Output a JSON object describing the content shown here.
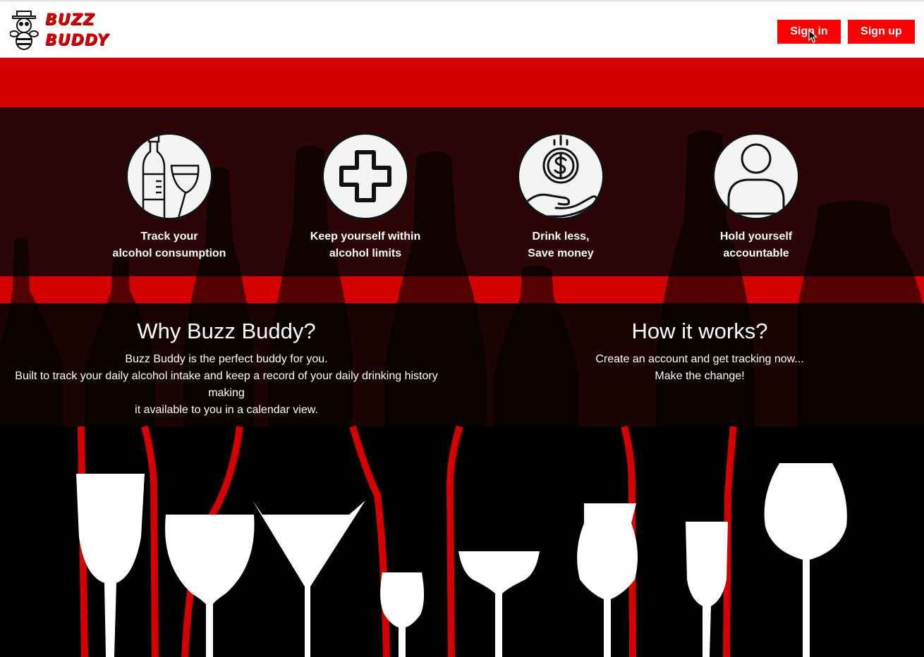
{
  "brand": {
    "line1": "BUZZ",
    "line2": "BUDDY",
    "logo_icon": "bee-mascot-icon"
  },
  "nav": {
    "signin_label": "Sign in",
    "signup_label": "Sign up"
  },
  "colors": {
    "accent": "#ff0000",
    "band_red": "#d40000",
    "dark_overlay": "#2a0505",
    "background": "#000000"
  },
  "features": [
    {
      "icon": "wine-bottle-glass-icon",
      "line1": "Track your",
      "line2": "alcohol consumption"
    },
    {
      "icon": "medical-cross-icon",
      "line1": "Keep yourself within",
      "line2": "alcohol limits"
    },
    {
      "icon": "money-hand-icon",
      "line1": "Drink less,",
      "line2": "Save money"
    },
    {
      "icon": "user-icon",
      "line1": "Hold yourself",
      "line2": "accountable"
    }
  ],
  "why": {
    "title": "Why Buzz Buddy?",
    "line1": "Buzz Buddy is the perfect buddy for you.",
    "line2": "Built to track your daily alcohol intake and keep a record of your daily drinking history making",
    "line3": "it available to you in a calendar view."
  },
  "how": {
    "title": "How it works?",
    "line1": "Create an account and get tracking now...",
    "line2": "Make the change!"
  }
}
